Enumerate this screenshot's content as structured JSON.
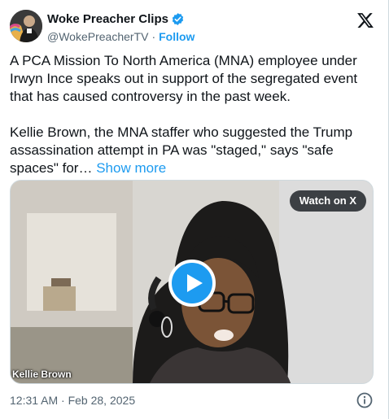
{
  "tweet": {
    "author": {
      "display_name": "Woke Preacher Clips",
      "handle": "@WokePreacherTV",
      "separator": "·",
      "follow_label": "Follow",
      "verified": true
    },
    "brand_icon": "x-logo-icon",
    "paragraphs": [
      "A PCA Mission To North America (MNA) employee under Irwyn Ince speaks out in support of the segregated event that has caused controversy in the past week.",
      "Kellie Brown, the MNA staffer who suggested the Trump assassination attempt in PA was \"staged,\" says \"safe spaces\" for…"
    ],
    "show_more_label": "Show more",
    "media": {
      "watch_label": "Watch on X",
      "caption": "Kellie Brown",
      "play_icon": "play-icon"
    },
    "timestamp": "12:31 AM · Feb 28, 2025",
    "info_icon": "info-icon"
  },
  "colors": {
    "accent": "#1d9bf0",
    "text": "#0f1419",
    "secondary_text": "#536471"
  }
}
